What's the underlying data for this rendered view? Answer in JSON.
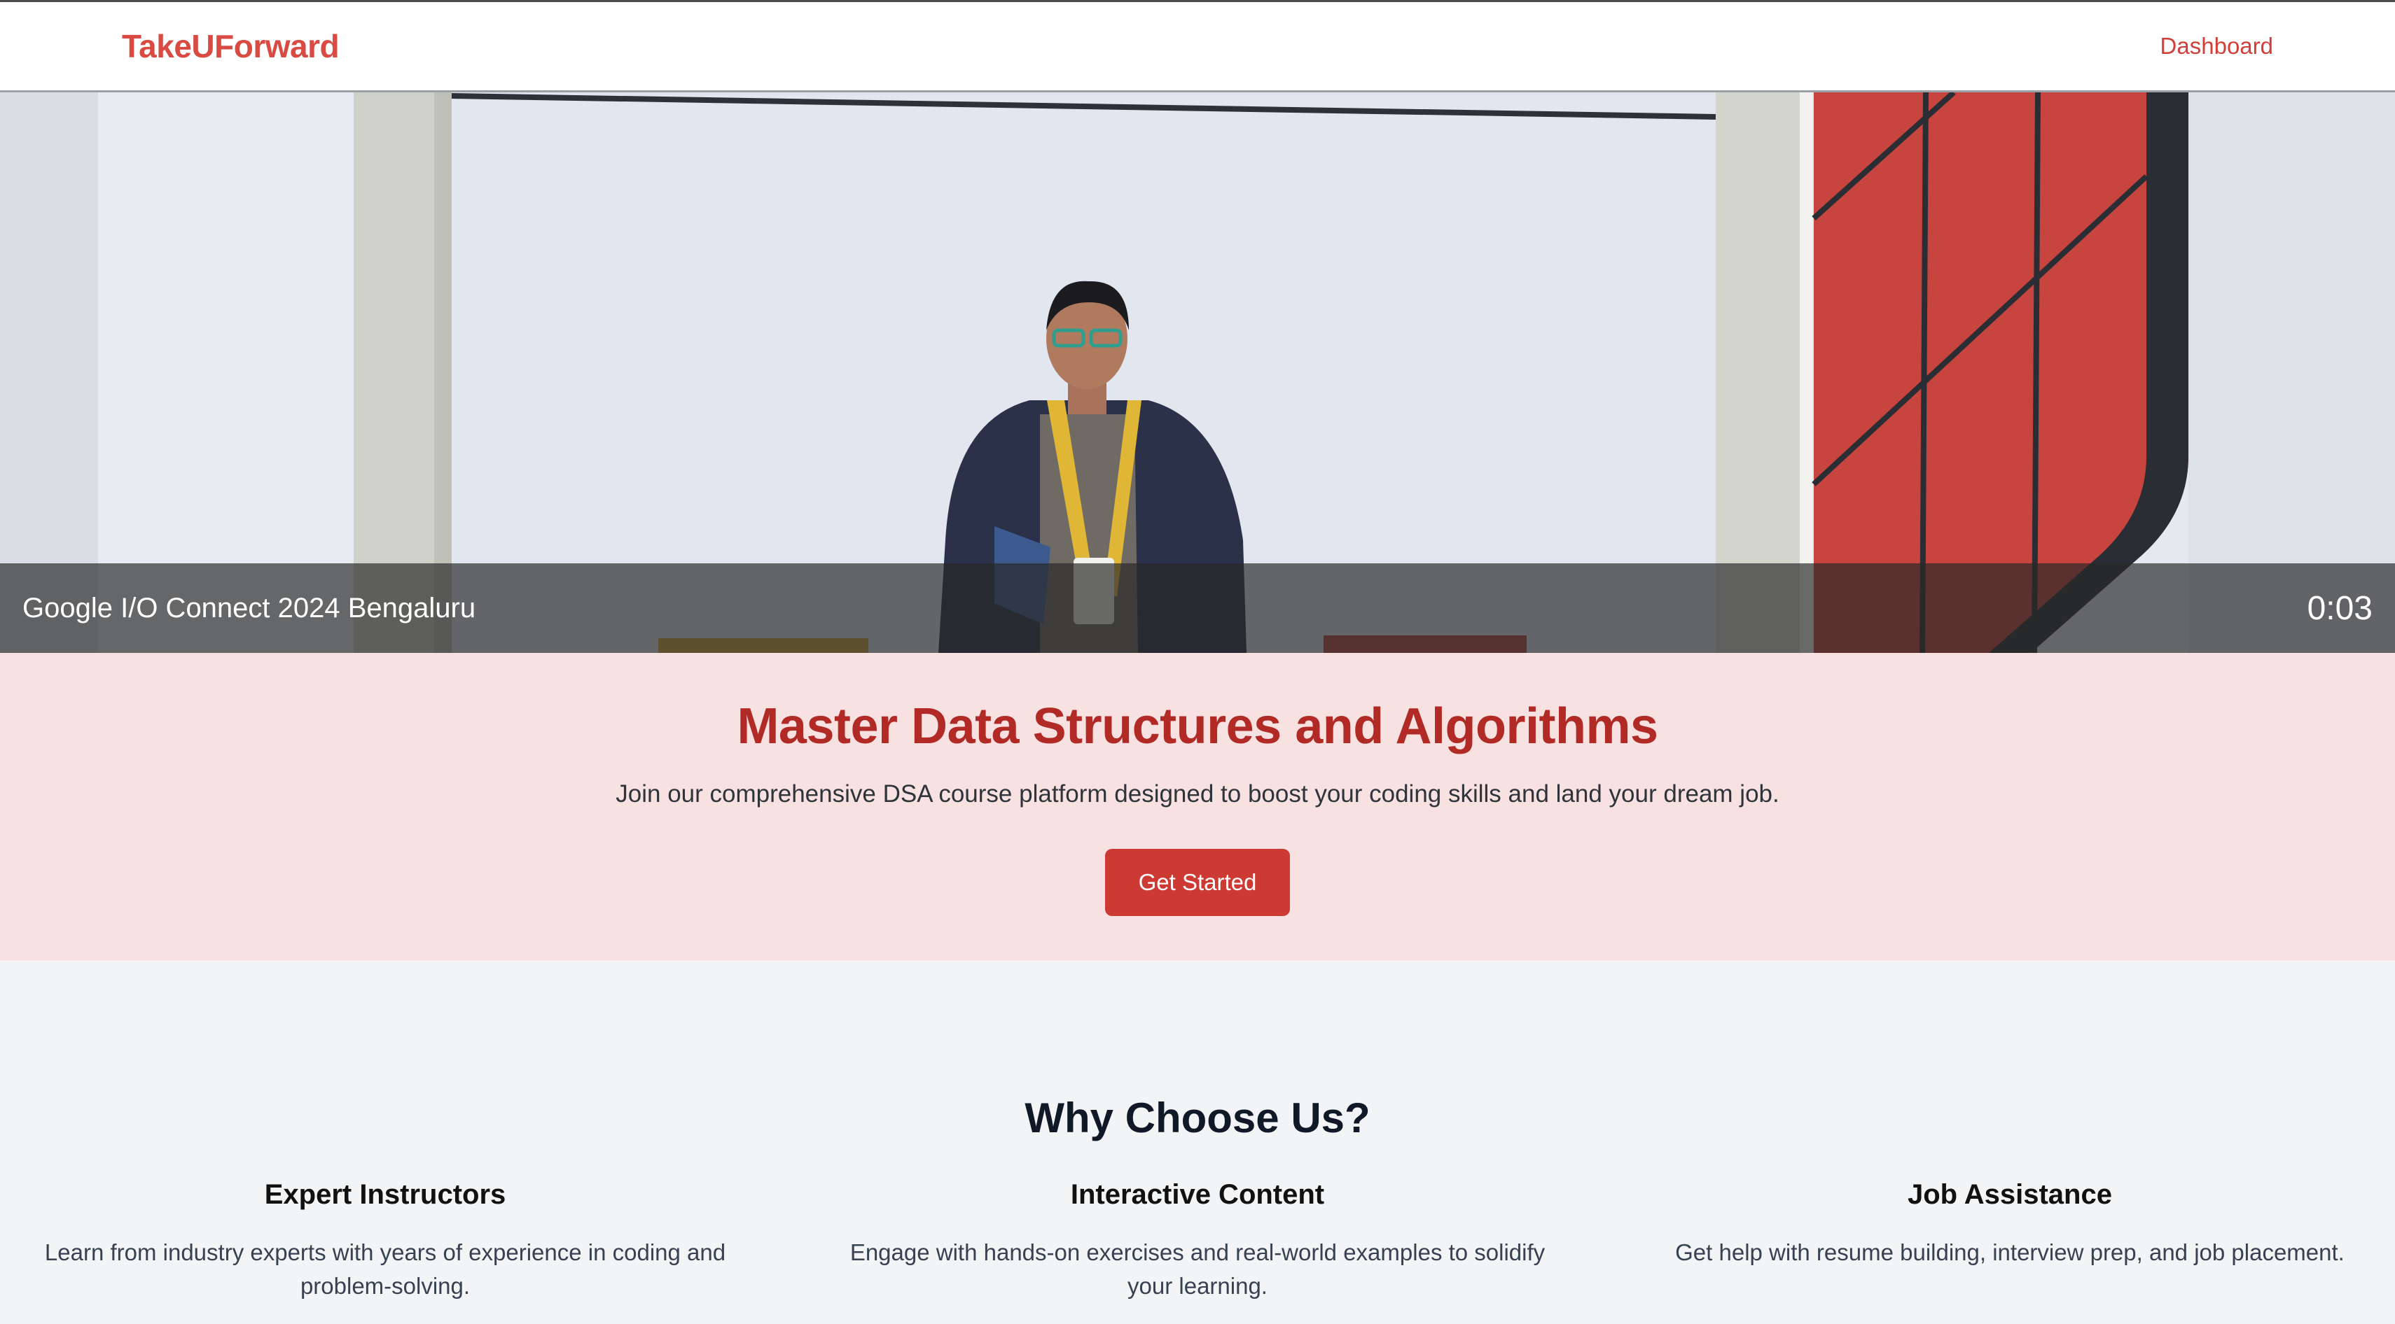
{
  "navbar": {
    "brand": "TakeUForward",
    "dashboard_label": "Dashboard"
  },
  "video": {
    "title": "Google I/O Connect 2024 Bengaluru",
    "timestamp": "0:03"
  },
  "hero": {
    "title": "Master Data Structures and Algorithms",
    "subtitle": "Join our comprehensive DSA course platform designed to boost your coding skills and land your dream job.",
    "cta_label": "Get Started"
  },
  "features": {
    "title": "Why Choose Us?",
    "items": [
      {
        "title": "Expert Instructors",
        "description": "Learn from industry experts with years of experience in coding and problem-solving."
      },
      {
        "title": "Interactive Content",
        "description": "Engage with hands-on exercises and real-world examples to solidify your learning."
      },
      {
        "title": "Job Assistance",
        "description": "Get help with resume building, interview prep, and job placement."
      }
    ]
  },
  "colors": {
    "brand_red": "#d94a43",
    "hero_title_red": "#b12a25",
    "cta_button": "#cd3a33",
    "hero_bg": "#f7e1e1",
    "page_bg": "#f3f4f6"
  }
}
